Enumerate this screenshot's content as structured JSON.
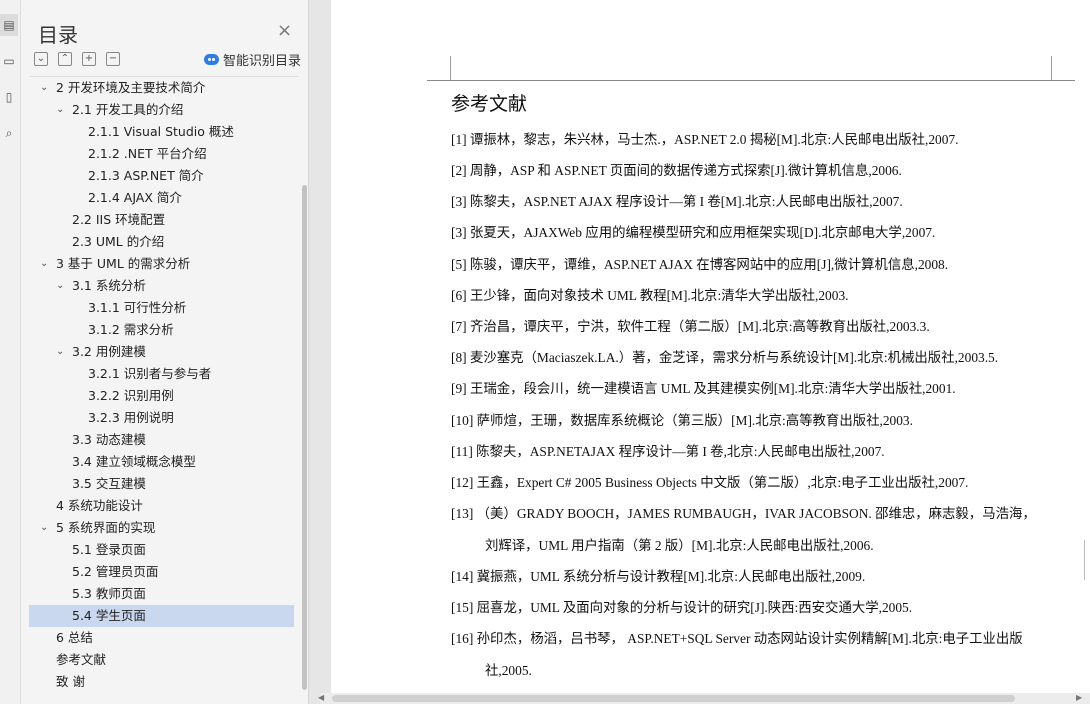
{
  "rail": {
    "icons": [
      "outline-icon",
      "bookmark-icon",
      "pages-icon",
      "search-icon"
    ]
  },
  "toc": {
    "title": "目录",
    "smart_label": "智能识别目录",
    "tool_icons": [
      "collapse-all-icon",
      "expand-all-icon",
      "add-heading-icon",
      "remove-heading-icon"
    ],
    "items": [
      {
        "label": "2  开发环境及主要技术简介",
        "level": 1,
        "chevron": true
      },
      {
        "label": "2.1  开发工具的介绍",
        "level": 2,
        "chevron": true
      },
      {
        "label": "2.1.1 Visual Studio 概述",
        "level": 3,
        "chevron": false
      },
      {
        "label": "2.1.2 .NET 平台介绍",
        "level": 3,
        "chevron": false
      },
      {
        "label": "2.1.3 ASP.NET 简介",
        "level": 3,
        "chevron": false
      },
      {
        "label": "2.1.4 AJAX 简介",
        "level": 3,
        "chevron": false
      },
      {
        "label": "2.2 IIS 环境配置",
        "level": 2,
        "chevron": false
      },
      {
        "label": "2.3 UML 的介绍",
        "level": 2,
        "chevron": false
      },
      {
        "label": "3  基于 UML 的需求分析",
        "level": 1,
        "chevron": true
      },
      {
        "label": "3.1  系统分析",
        "level": 2,
        "chevron": true
      },
      {
        "label": "3.1.1  可行性分析",
        "level": 3,
        "chevron": false
      },
      {
        "label": "3.1.2  需求分析",
        "level": 3,
        "chevron": false
      },
      {
        "label": "3.2  用例建模",
        "level": 2,
        "chevron": true
      },
      {
        "label": "3.2.1  识别者与参与者",
        "level": 3,
        "chevron": false
      },
      {
        "label": "3.2.2  识别用例",
        "level": 3,
        "chevron": false
      },
      {
        "label": "3.2.3  用例说明",
        "level": 3,
        "chevron": false
      },
      {
        "label": "3.3  动态建模",
        "level": 2,
        "chevron": false
      },
      {
        "label": "3.4  建立领域概念模型",
        "level": 2,
        "chevron": false
      },
      {
        "label": "3.5  交互建模",
        "level": 2,
        "chevron": false
      },
      {
        "label": "4  系统功能设计",
        "level": 1,
        "chevron": false
      },
      {
        "label": "5  系统界面的实现",
        "level": 1,
        "chevron": true
      },
      {
        "label": "5.1  登录页面",
        "level": 2,
        "chevron": false
      },
      {
        "label": "5.2  管理员页面",
        "level": 2,
        "chevron": false
      },
      {
        "label": "5.3  教师页面",
        "level": 2,
        "chevron": false
      },
      {
        "label": "5.4  学生页面",
        "level": 2,
        "chevron": false,
        "selected": true
      },
      {
        "label": "6  总结",
        "level": 1,
        "chevron": false
      },
      {
        "label": "参考文献",
        "level": 1,
        "chevron": false
      },
      {
        "label": "致   谢",
        "level": 1,
        "chevron": false
      }
    ]
  },
  "document": {
    "heading": "参考文献",
    "references": [
      {
        "text": "[1]  谭振林，黎志，朱兴林，马士杰.，ASP.NET 2.0 揭秘[M].北京:人民邮电出版社,2007."
      },
      {
        "text": "[2]  周静，ASP 和 ASP.NET 页面间的数据传递方式探索[J].微计算机信息,2006."
      },
      {
        "text": "[3]  陈黎夫，ASP.NET AJAX 程序设计—第 I 卷[M].北京:人民邮电出版社,2007."
      },
      {
        "text": "[3]  张夏天，AJAXWeb 应用的编程模型研究和应用框架实现[D].北京邮电大学,2007."
      },
      {
        "text": "[5]  陈骏，谭庆平，谭维，ASP.NET AJAX 在博客网站中的应用[J],微计算机信息,2008."
      },
      {
        "text": "[6]  王少锋，面向对象技术 UML 教程[M].北京:清华大学出版社,2003."
      },
      {
        "text": "[7]  齐治昌，谭庆平，宁洪，软件工程（第二版）[M].北京:高等教育出版社,2003.3."
      },
      {
        "text": "[8]  麦沙塞克（Maciaszek.LA.）著，金芝译，需求分析与系统设计[M].北京:机械出版社,2003.5."
      },
      {
        "text": "[9]  王瑞金，段会川，统一建模语言 UML 及其建模实例[M].北京:清华大学出版社,2001."
      },
      {
        "text": "[10]  萨师煊，王珊，数据库系统概论（第三版）[M].北京:高等教育出版社,2003."
      },
      {
        "text": "[11]  陈黎夫，ASP.NETAJAX 程序设计—第 I 卷,北京:人民邮电出版社,2007."
      },
      {
        "text": "[12]  王鑫，Expert C# 2005 Business Objects 中文版（第二版）,北京:电子工业出版社,2007."
      },
      {
        "text": "[13]  （美）GRADY BOOCH，JAMES RUMBAUGH，IVAR JACOBSON. 邵维忠，麻志毅，马浩海，",
        "cont": "刘辉译，UML 用户指南（第 2 版）[M].北京:人民邮电出版社,2006."
      },
      {
        "text": "[14]  冀振燕，UML 系统分析与设计教程[M].北京:人民邮电出版社,2009."
      },
      {
        "text": "[15]  屈喜龙，UML 及面向对象的分析与设计的研究[J].陕西:西安交通大学,2005."
      },
      {
        "text": "[16]  孙印杰，杨滔，吕书琴，  ASP.NET+SQL Server 动态网站设计实例精解[M].北京:电子工业出版",
        "cont": "社,2005."
      }
    ]
  }
}
